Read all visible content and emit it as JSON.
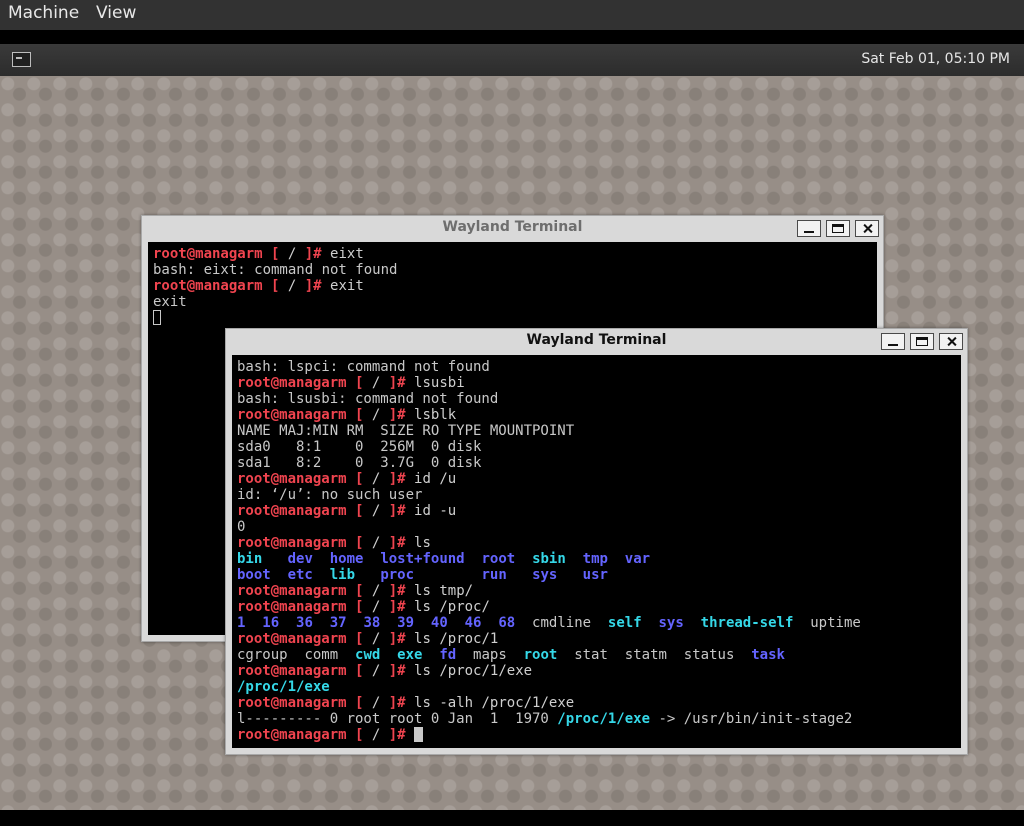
{
  "host_menu": {
    "machine": "Machine",
    "view": "View"
  },
  "panel": {
    "clock": "Sat Feb 01, 05:10 PM"
  },
  "prompt": {
    "user": "root@managarm",
    "open": "[",
    "path": " / ",
    "close": "]#"
  },
  "windows": [
    {
      "title": "Wayland Terminal",
      "lines": [
        {
          "type": "prompt",
          "cmd": "eixt"
        },
        {
          "type": "output",
          "text": "bash: eixt: command not found"
        },
        {
          "type": "prompt",
          "cmd": "exit"
        },
        {
          "type": "output",
          "text": "exit"
        },
        {
          "type": "cursor-outline"
        }
      ]
    },
    {
      "title": "Wayland Terminal",
      "lines": [
        {
          "type": "output",
          "text": "bash: lspci: command not found"
        },
        {
          "type": "prompt",
          "cmd": "lsusbi"
        },
        {
          "type": "output",
          "text": "bash: lsusbi: command not found"
        },
        {
          "type": "prompt",
          "cmd": "lsblk"
        },
        {
          "type": "output",
          "text": "NAME MAJ:MIN RM  SIZE RO TYPE MOUNTPOINT"
        },
        {
          "type": "output",
          "text": "sda0   8:1    0  256M  0 disk"
        },
        {
          "type": "output",
          "text": "sda1   8:2    0  3.7G  0 disk"
        },
        {
          "type": "prompt",
          "cmd": "id /u"
        },
        {
          "type": "output",
          "text": "id: ‘/u’: no such user"
        },
        {
          "type": "prompt",
          "cmd": "id -u"
        },
        {
          "type": "output",
          "text": "0"
        },
        {
          "type": "prompt",
          "cmd": "ls"
        },
        {
          "type": "segs",
          "segs": [
            {
              "t": "bin",
              "c": "cyan"
            },
            {
              "t": "   ",
              "c": "plain"
            },
            {
              "t": "dev",
              "c": "blue"
            },
            {
              "t": "  ",
              "c": "plain"
            },
            {
              "t": "home",
              "c": "blue"
            },
            {
              "t": "  ",
              "c": "plain"
            },
            {
              "t": "lost+found",
              "c": "blue"
            },
            {
              "t": "  ",
              "c": "plain"
            },
            {
              "t": "root",
              "c": "blue"
            },
            {
              "t": "  ",
              "c": "plain"
            },
            {
              "t": "sbin",
              "c": "cyan"
            },
            {
              "t": "  ",
              "c": "plain"
            },
            {
              "t": "tmp",
              "c": "blue"
            },
            {
              "t": "  ",
              "c": "plain"
            },
            {
              "t": "var",
              "c": "blue"
            }
          ]
        },
        {
          "type": "segs",
          "segs": [
            {
              "t": "boot",
              "c": "blue"
            },
            {
              "t": "  ",
              "c": "plain"
            },
            {
              "t": "etc",
              "c": "blue"
            },
            {
              "t": "  ",
              "c": "plain"
            },
            {
              "t": "lib",
              "c": "cyan"
            },
            {
              "t": "   ",
              "c": "plain"
            },
            {
              "t": "proc",
              "c": "blue"
            },
            {
              "t": "        ",
              "c": "plain"
            },
            {
              "t": "run",
              "c": "blue"
            },
            {
              "t": "   ",
              "c": "plain"
            },
            {
              "t": "sys",
              "c": "blue"
            },
            {
              "t": "   ",
              "c": "plain"
            },
            {
              "t": "usr",
              "c": "blue"
            }
          ]
        },
        {
          "type": "prompt",
          "cmd": "ls tmp/"
        },
        {
          "type": "prompt",
          "cmd": "ls /proc/"
        },
        {
          "type": "segs",
          "segs": [
            {
              "t": "1",
              "c": "blue"
            },
            {
              "t": "  ",
              "c": "plain"
            },
            {
              "t": "16",
              "c": "blue"
            },
            {
              "t": "  ",
              "c": "plain"
            },
            {
              "t": "36",
              "c": "blue"
            },
            {
              "t": "  ",
              "c": "plain"
            },
            {
              "t": "37",
              "c": "blue"
            },
            {
              "t": "  ",
              "c": "plain"
            },
            {
              "t": "38",
              "c": "blue"
            },
            {
              "t": "  ",
              "c": "plain"
            },
            {
              "t": "39",
              "c": "blue"
            },
            {
              "t": "  ",
              "c": "plain"
            },
            {
              "t": "40",
              "c": "blue"
            },
            {
              "t": "  ",
              "c": "plain"
            },
            {
              "t": "46",
              "c": "blue"
            },
            {
              "t": "  ",
              "c": "plain"
            },
            {
              "t": "68",
              "c": "blue"
            },
            {
              "t": "  ",
              "c": "plain"
            },
            {
              "t": "cmdline",
              "c": "plain"
            },
            {
              "t": "  ",
              "c": "plain"
            },
            {
              "t": "self",
              "c": "cyan"
            },
            {
              "t": "  ",
              "c": "plain"
            },
            {
              "t": "sys",
              "c": "blue"
            },
            {
              "t": "  ",
              "c": "plain"
            },
            {
              "t": "thread-self",
              "c": "cyan"
            },
            {
              "t": "  ",
              "c": "plain"
            },
            {
              "t": "uptime",
              "c": "plain"
            }
          ]
        },
        {
          "type": "prompt",
          "cmd": "ls /proc/1"
        },
        {
          "type": "segs",
          "segs": [
            {
              "t": "cgroup",
              "c": "plain"
            },
            {
              "t": "  ",
              "c": "plain"
            },
            {
              "t": "comm",
              "c": "plain"
            },
            {
              "t": "  ",
              "c": "plain"
            },
            {
              "t": "cwd",
              "c": "cyan"
            },
            {
              "t": "  ",
              "c": "plain"
            },
            {
              "t": "exe",
              "c": "cyan"
            },
            {
              "t": "  ",
              "c": "plain"
            },
            {
              "t": "fd",
              "c": "blue"
            },
            {
              "t": "  ",
              "c": "plain"
            },
            {
              "t": "maps",
              "c": "plain"
            },
            {
              "t": "  ",
              "c": "plain"
            },
            {
              "t": "root",
              "c": "cyan"
            },
            {
              "t": "  ",
              "c": "plain"
            },
            {
              "t": "stat",
              "c": "plain"
            },
            {
              "t": "  ",
              "c": "plain"
            },
            {
              "t": "statm",
              "c": "plain"
            },
            {
              "t": "  ",
              "c": "plain"
            },
            {
              "t": "status",
              "c": "plain"
            },
            {
              "t": "  ",
              "c": "plain"
            },
            {
              "t": "task",
              "c": "blue"
            }
          ]
        },
        {
          "type": "prompt",
          "cmd": "ls /proc/1/exe"
        },
        {
          "type": "segs",
          "segs": [
            {
              "t": "/proc/1/exe",
              "c": "cyan"
            }
          ]
        },
        {
          "type": "prompt",
          "cmd": "ls -alh /proc/1/exe"
        },
        {
          "type": "segs",
          "segs": [
            {
              "t": "l--------- 0 root root 0 Jan  1  1970 ",
              "c": "plain"
            },
            {
              "t": "/proc/1/exe",
              "c": "cyan"
            },
            {
              "t": " -> /usr/bin/init-stage2",
              "c": "plain"
            }
          ]
        },
        {
          "type": "prompt",
          "cmd": "",
          "cursor": true
        }
      ]
    }
  ],
  "colors": {
    "prompt": "#f0444f",
    "dir": "#6464ff",
    "link": "#35d8e8",
    "text": "#c8c8c8",
    "terminal_bg": "#000000"
  },
  "icons": {
    "terminal_launcher": "terminal-icon",
    "minimize": "minimize-icon",
    "maximize": "maximize-icon",
    "close": "close-icon"
  }
}
